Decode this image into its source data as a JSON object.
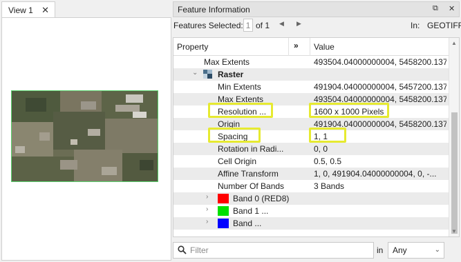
{
  "view": {
    "tab_label": "View 1",
    "close_glyph": "✕"
  },
  "panel": {
    "title": "Feature Information",
    "pin_glyph": "⧉",
    "close_glyph": "✕",
    "selected_label": "Features Selected:",
    "selected_index": "1",
    "of_total": "of 1",
    "prev_glyph": "◀",
    "next_glyph": "▶",
    "in_label": "In:",
    "format": "GEOTIFF"
  },
  "table": {
    "header_property": "Property",
    "header_expand": "»",
    "header_value": "Value",
    "rows": [
      {
        "property": "Max Extents",
        "value": "493504.04000000004, 5458200.137"
      },
      {
        "property": "Raster",
        "value": ""
      },
      {
        "property": "Min Extents",
        "value": "491904.04000000004, 5457200.137"
      },
      {
        "property": "Max Extents",
        "value": "493504.04000000004, 5458200.137"
      },
      {
        "property": "Resolution ...",
        "value": "1600 x 1000 Pixels"
      },
      {
        "property": "Origin",
        "value": "491904.04000000004, 5458200.137"
      },
      {
        "property": "Spacing",
        "value": "1, 1"
      },
      {
        "property": "Rotation in Radi...",
        "value": "0, 0"
      },
      {
        "property": "Cell Origin",
        "value": "0.5, 0.5"
      },
      {
        "property": "Affine Transform",
        "value": "1, 0, 491904.04000000004, 0, -..."
      },
      {
        "property": "Number Of Bands",
        "value": "3 Bands"
      },
      {
        "property": "Band 0 (RED8)",
        "value": ""
      },
      {
        "property": "Band 1 ...",
        "value": ""
      },
      {
        "property": "Band ...",
        "value": ""
      }
    ],
    "band_colors": [
      "#ff0000",
      "#00e000",
      "#0000ff"
    ],
    "highlight_color": "#e6ea30"
  },
  "filter": {
    "placeholder": "Filter",
    "in_label": "in",
    "scope_value": "Any"
  }
}
